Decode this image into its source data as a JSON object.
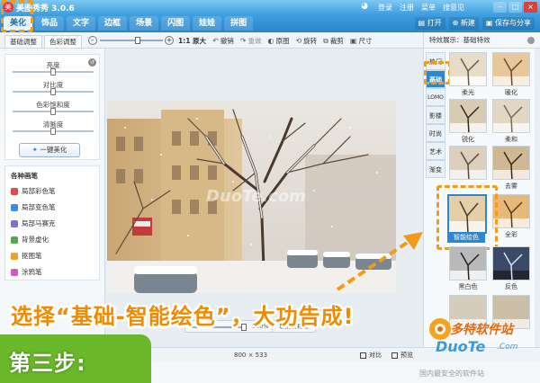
{
  "titlebar": {
    "title": "美图秀秀 3.0.6",
    "links": [
      "登录",
      "注册",
      "菜单",
      "搜意见"
    ]
  },
  "tabs": [
    "美化",
    "饰品",
    "文字",
    "边框",
    "场景",
    "闪图",
    "娃娃",
    "拼图"
  ],
  "top_actions": {
    "open": "打开",
    "new": "新建",
    "save_share": "保存与分享"
  },
  "toolbar": {
    "sub_tabs": [
      "基础调整",
      "色彩调整"
    ],
    "zoom_label": "1:1 原大",
    "tools": [
      {
        "icon": "↶",
        "label": "撤销",
        "disabled": false
      },
      {
        "icon": "↷",
        "label": "重做",
        "disabled": true
      },
      {
        "icon": "◐",
        "label": "原图",
        "disabled": false
      },
      {
        "icon": "⟲",
        "label": "旋转",
        "disabled": false
      },
      {
        "icon": "⧉",
        "label": "裁剪",
        "disabled": false
      },
      {
        "icon": "▣",
        "label": "尺寸",
        "disabled": false
      }
    ]
  },
  "left_panel": {
    "sliders": [
      {
        "label": "亮度",
        "value": 0.5
      },
      {
        "label": "对比度",
        "value": 0.5
      },
      {
        "label": "色彩饱和度",
        "value": 0.5
      },
      {
        "label": "清晰度",
        "value": 0.5
      }
    ],
    "one_click": "一键美化",
    "brush_title": "各种画笔",
    "brushes": [
      {
        "label": "局部彩色笔",
        "color": "#e04b4b"
      },
      {
        "label": "局部变色笔",
        "color": "#3a8ee6"
      },
      {
        "label": "局部马赛克",
        "color": "#8a6bd1"
      },
      {
        "label": "背景虚化",
        "color": "#55a845"
      },
      {
        "label": "抠图笔",
        "color": "#e9a22a"
      },
      {
        "label": "涂鸦笔",
        "color": "#d65ab7"
      }
    ]
  },
  "canvas": {
    "watermark": "DuoTe.com",
    "compare_pct": "100%",
    "cancel_effect": "取消该特效"
  },
  "right_panel": {
    "header": "特效展示：基础特效",
    "categories": [
      "热门",
      "基础",
      "LOMO",
      "影楼",
      "时尚",
      "艺术",
      "渐变"
    ],
    "active_category": "基础",
    "effects": [
      {
        "label": "柔光"
      },
      {
        "label": "暖化"
      },
      {
        "label": "锐化"
      },
      {
        "label": "柔和"
      },
      {
        "label": ""
      },
      {
        "label": "去雾"
      },
      {
        "label": "智能绘色"
      },
      {
        "label": "全彩"
      },
      {
        "label": "黑白色"
      },
      {
        "label": "反色"
      }
    ],
    "selected_effect": "智能绘色"
  },
  "status": {
    "size": "800 × 533",
    "compare": "对比",
    "preview": "预览"
  },
  "overlay": {
    "caption": "选择“基础-智能绘色”，大功告成!",
    "step": "第三步:",
    "logo_cn": "多特软件站",
    "logo_en": "DuoTe",
    "logo_com": ".Com",
    "site_note": "国内最安全的软件站",
    "highlight_color": "#f39b18",
    "step_color": "#6cb82c"
  }
}
